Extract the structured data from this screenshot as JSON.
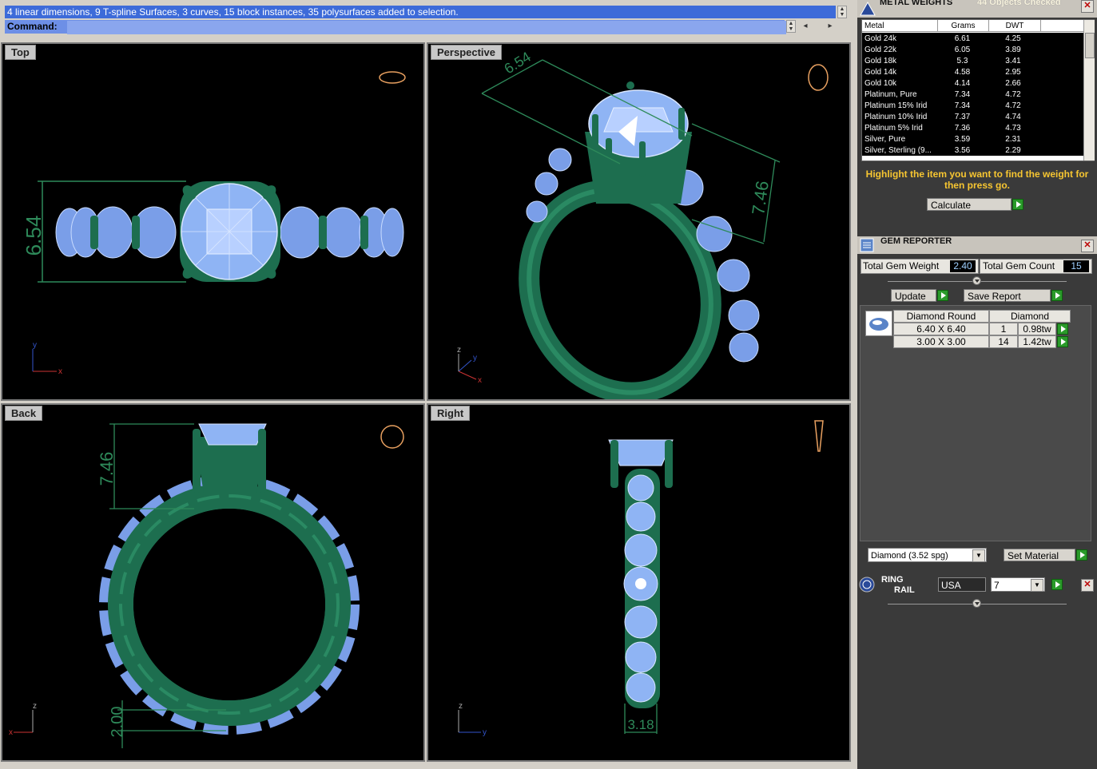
{
  "command": {
    "history": "4 linear dimensions, 9 T-spline Surfaces, 3 curves, 15 block instances, 35 polysurfaces added to selection.",
    "prompt": "Command:"
  },
  "viewports": {
    "top": {
      "label": "Top",
      "dim": "6.54"
    },
    "perspective": {
      "label": "Perspective",
      "dim_a": "6.54",
      "dim_b": "7.46"
    },
    "back": {
      "label": "Back",
      "dim_a": "7.46",
      "dim_b": "2.00"
    },
    "right": {
      "label": "Right",
      "dim": "3.18"
    }
  },
  "metal_weights": {
    "title": "METAL WEIGHTS",
    "objects_checked": "44 Objects Checked",
    "columns": [
      "Metal",
      "Grams",
      "DWT"
    ],
    "rows": [
      {
        "metal": "Gold 24k",
        "grams": "6.61",
        "dwt": "4.25"
      },
      {
        "metal": "Gold 22k",
        "grams": "6.05",
        "dwt": "3.89"
      },
      {
        "metal": "Gold 18k",
        "grams": "5.3",
        "dwt": "3.41"
      },
      {
        "metal": "Gold 14k",
        "grams": "4.58",
        "dwt": "2.95"
      },
      {
        "metal": "Gold 10k",
        "grams": "4.14",
        "dwt": "2.66"
      },
      {
        "metal": "Platinum, Pure",
        "grams": "7.34",
        "dwt": "4.72"
      },
      {
        "metal": "Platinum 15% Irid",
        "grams": "7.34",
        "dwt": "4.72"
      },
      {
        "metal": "Platinum 10% Irid",
        "grams": "7.37",
        "dwt": "4.74"
      },
      {
        "metal": "Platinum 5% Irid",
        "grams": "7.36",
        "dwt": "4.73"
      },
      {
        "metal": "Silver, Pure",
        "grams": "3.59",
        "dwt": "2.31"
      },
      {
        "metal": "Silver, Sterling (9...",
        "grams": "3.56",
        "dwt": "2.29"
      }
    ],
    "hint": "Highlight the item you want to find the weight for then press go.",
    "calculate_label": "Calculate"
  },
  "gem_reporter": {
    "title": "GEM REPORTER",
    "total_weight_label": "Total Gem Weight",
    "total_weight": "2.40",
    "total_count_label": "Total Gem Count",
    "total_count": "15",
    "update_label": "Update",
    "save_label": "Save Report",
    "table_header": {
      "shape": "Diamond Round",
      "material": "Diamond"
    },
    "rows": [
      {
        "size": "6.40 X 6.40",
        "count": "1",
        "tw": "0.98tw"
      },
      {
        "size": "3.00 X 3.00",
        "count": "14",
        "tw": "1.42tw"
      }
    ],
    "material_select": "Diamond    (3.52 spg)",
    "set_material_label": "Set Material"
  },
  "ring_rail": {
    "title_line1": "RING",
    "title_line2": "RAIL",
    "standard": "USA",
    "size": "7"
  },
  "colors": {
    "metal": "#1d6e4f",
    "gem": "#a8c8ff",
    "dimension": "#2e8a5a",
    "highlight": "#3d6bd9",
    "hint": "#f7c631"
  }
}
